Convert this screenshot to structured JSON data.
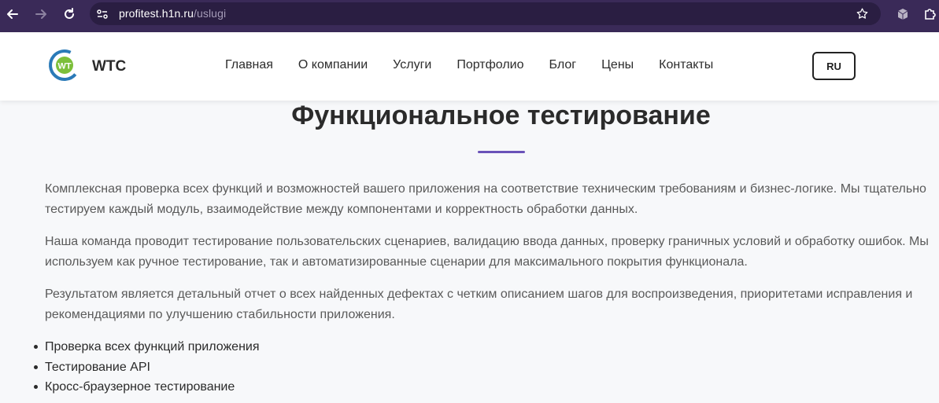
{
  "browser": {
    "url_host": "profitest.h1n.ru",
    "url_path": "/uslugi",
    "icons": [
      "back-arrow-icon",
      "forward-arrow-icon",
      "reload-icon",
      "site-settings-icon",
      "bookmark-star-icon",
      "extension-cube-icon",
      "extensions-puzzle-icon"
    ]
  },
  "header": {
    "brand": "WTC",
    "menu": [
      "Главная",
      "О компании",
      "Услуги",
      "Портфолио",
      "Блог",
      "Цены",
      "Контакты"
    ],
    "lang_label": "RU"
  },
  "main": {
    "title": "Функциональное тестирование",
    "paragraphs": [
      "Комплексная проверка всех функций и возможностей вашего приложения на соответствие техническим требованиям и бизнес-логике. Мы тщательно тестируем каждый модуль, взаимодействие между компонентами и корректность обработки данных.",
      "Наша команда проводит тестирование пользовательских сценариев, валидацию ввода данных, проверку граничных условий и обработку ошибок. Мы используем как ручное тестирование, так и автоматизированные сценарии для максимального покрытия функционала.",
      "Результатом является детальный отчет о всех найденных дефектах с четким описанием шагов для воспроизведения, приоритетами исправления и рекомендациями по улучшению стабильности приложения."
    ],
    "features": [
      "Проверка всех функций приложения",
      "Тестирование API",
      "Кросс-браузерное тестирование"
    ]
  },
  "colors": {
    "chrome_bg": "#3a2a58",
    "accent": "#6a52b8",
    "logo_green": "#7cbf3a",
    "logo_blue": "#2a7ab8"
  }
}
